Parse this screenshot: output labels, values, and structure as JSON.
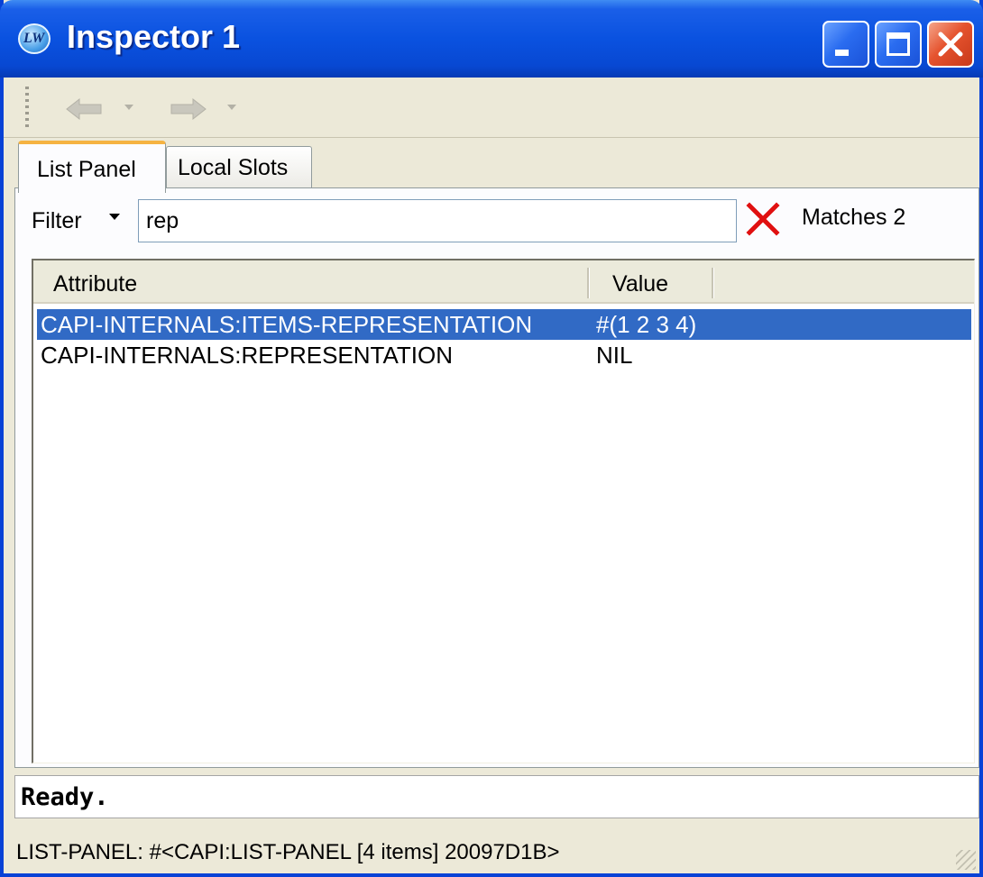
{
  "window": {
    "title": "Inspector 1",
    "app_icon": "lw-logo-icon",
    "controls": [
      "minimize-icon",
      "maximize-icon",
      "close-icon"
    ],
    "accent_color": "#0842d6"
  },
  "toolbar": {
    "back_icon": "arrow-left-icon",
    "forward_icon": "arrow-right-icon",
    "dropdown_icon": "chevron-down-icon"
  },
  "tabs": [
    {
      "label": "List Panel",
      "active": true
    },
    {
      "label": "Local Slots",
      "active": false
    }
  ],
  "filter": {
    "label": "Filter",
    "value": "rep",
    "clear_icon": "close-x-icon",
    "matches_text": "Matches 2"
  },
  "list": {
    "columns": [
      "Attribute",
      "Value"
    ],
    "rows": [
      {
        "attribute": "CAPI-INTERNALS:ITEMS-REPRESENTATION",
        "value": "#(1 2 3 4)",
        "selected": true
      },
      {
        "attribute": "CAPI-INTERNALS:REPRESENTATION",
        "value": "NIL",
        "selected": false
      }
    ],
    "selection_color": "#316ac5"
  },
  "echo_area": "Ready.",
  "status_bar": "LIST-PANEL: #<CAPI:LIST-PANEL [4 items] 20097D1B>"
}
